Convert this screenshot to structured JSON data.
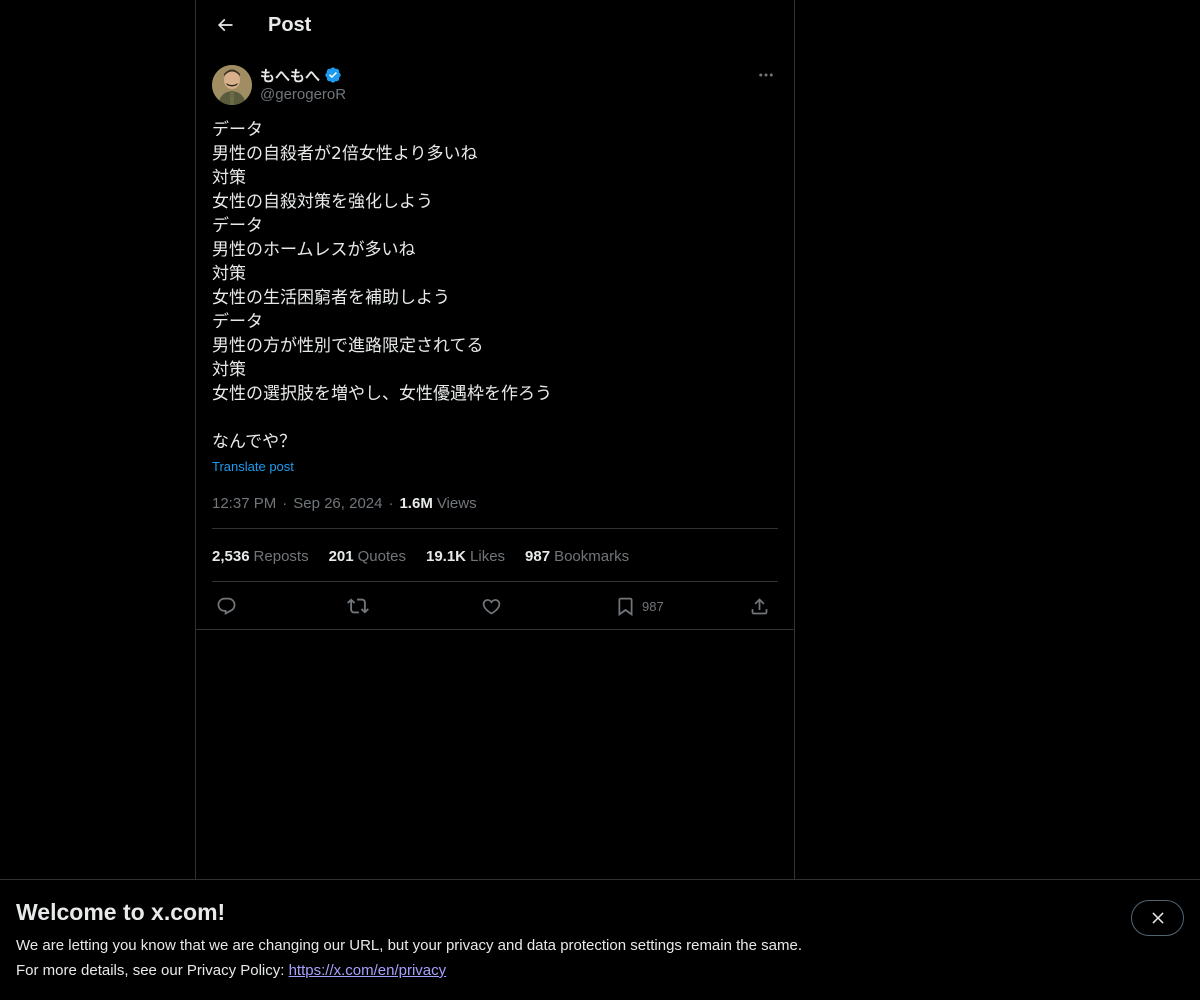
{
  "header": {
    "back_icon": "arrow-left-icon",
    "title": "Post"
  },
  "author": {
    "display_name": "もへもへ",
    "handle": "@gerogeroR",
    "verified_badge_icon": "verified-badge-icon",
    "verified_color": "#1d9bf0",
    "more_icon": "more-horizontal-icon"
  },
  "tweet": {
    "lines": [
      "データ",
      "男性の自殺者が2倍女性より多いね",
      "対策",
      "女性の自殺対策を強化しよう",
      "データ",
      "男性のホームレスが多いね",
      "対策",
      "女性の生活困窮者を補助しよう",
      "データ",
      "男性の方が性別で進路限定されてる",
      "対策",
      "女性の選択肢を増やし、女性優遇枠を作ろう",
      "",
      "なんでや？"
    ],
    "translate_label": "Translate post",
    "time": "12:37 PM",
    "date": "Sep 26, 2024",
    "views_count": "1.6M",
    "views_label": "Views"
  },
  "stats": {
    "reposts_count": "2,536",
    "reposts_label": "Reposts",
    "quotes_count": "201",
    "quotes_label": "Quotes",
    "likes_count": "19.1K",
    "likes_label": "Likes",
    "bookmarks_count": "987",
    "bookmarks_label": "Bookmarks"
  },
  "actions": {
    "reply_icon": "reply-icon",
    "repost_icon": "repost-icon",
    "like_icon": "heart-icon",
    "bookmark_icon": "bookmark-icon",
    "bookmark_count": "987",
    "share_icon": "share-icon"
  },
  "banner": {
    "title": "Welcome to x.com!",
    "line1": "We are letting you know that we are changing our URL, but your privacy and data protection settings remain the same.",
    "line2_prefix": "For more details, see our Privacy Policy: ",
    "link": "https://x.com/en/privacy",
    "close_icon": "close-icon"
  },
  "colors": {
    "background": "#000000",
    "text_primary": "#e7e9ea",
    "text_secondary": "#71767b",
    "accent": "#1d9bf0",
    "link_visited": "#a6a0ff",
    "border": "#2f3336"
  }
}
